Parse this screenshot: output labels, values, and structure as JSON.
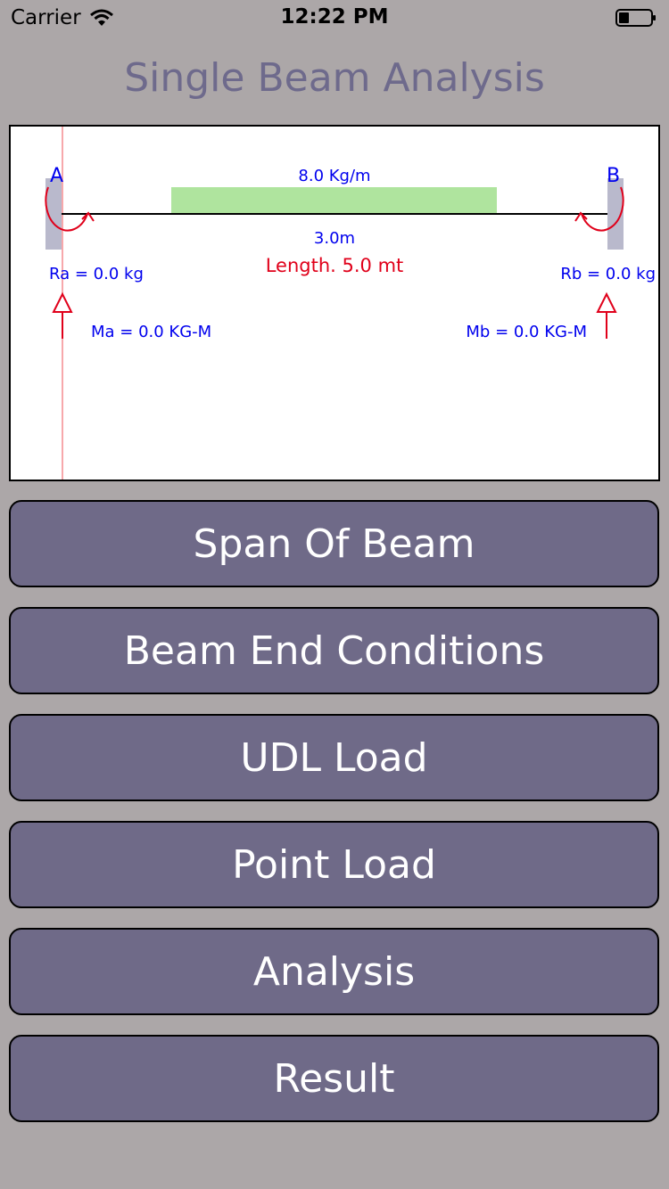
{
  "status_bar": {
    "carrier": "Carrier",
    "time": "12:22 PM"
  },
  "title": "Single Beam Analysis",
  "diagram": {
    "support_a_label": "A",
    "support_b_label": "B",
    "udl_label": "8.0 Kg/m",
    "udl_length_label": "3.0m",
    "length_label": "Length. 5.0 mt",
    "reaction_a": "Ra = 0.0 kg",
    "reaction_b": "Rb = 0.0 kg",
    "moment_a": "Ma = 0.0 KG-M",
    "moment_b": "Mb = 0.0 KG-M",
    "colors": {
      "label_blue": "#0000ee",
      "arrow_red": "#e0001a",
      "udl_green": "#afe49e",
      "support_gray": "#b9b9cc"
    }
  },
  "menu": {
    "span_of_beam": "Span Of Beam",
    "beam_end_conditions": "Beam End Conditions",
    "udl_load": "UDL Load",
    "point_load": "Point Load",
    "analysis": "Analysis",
    "result": "Result"
  },
  "colors": {
    "background": "#aca7a8",
    "button": "#6f6a88",
    "title": "#6e6a8c"
  }
}
